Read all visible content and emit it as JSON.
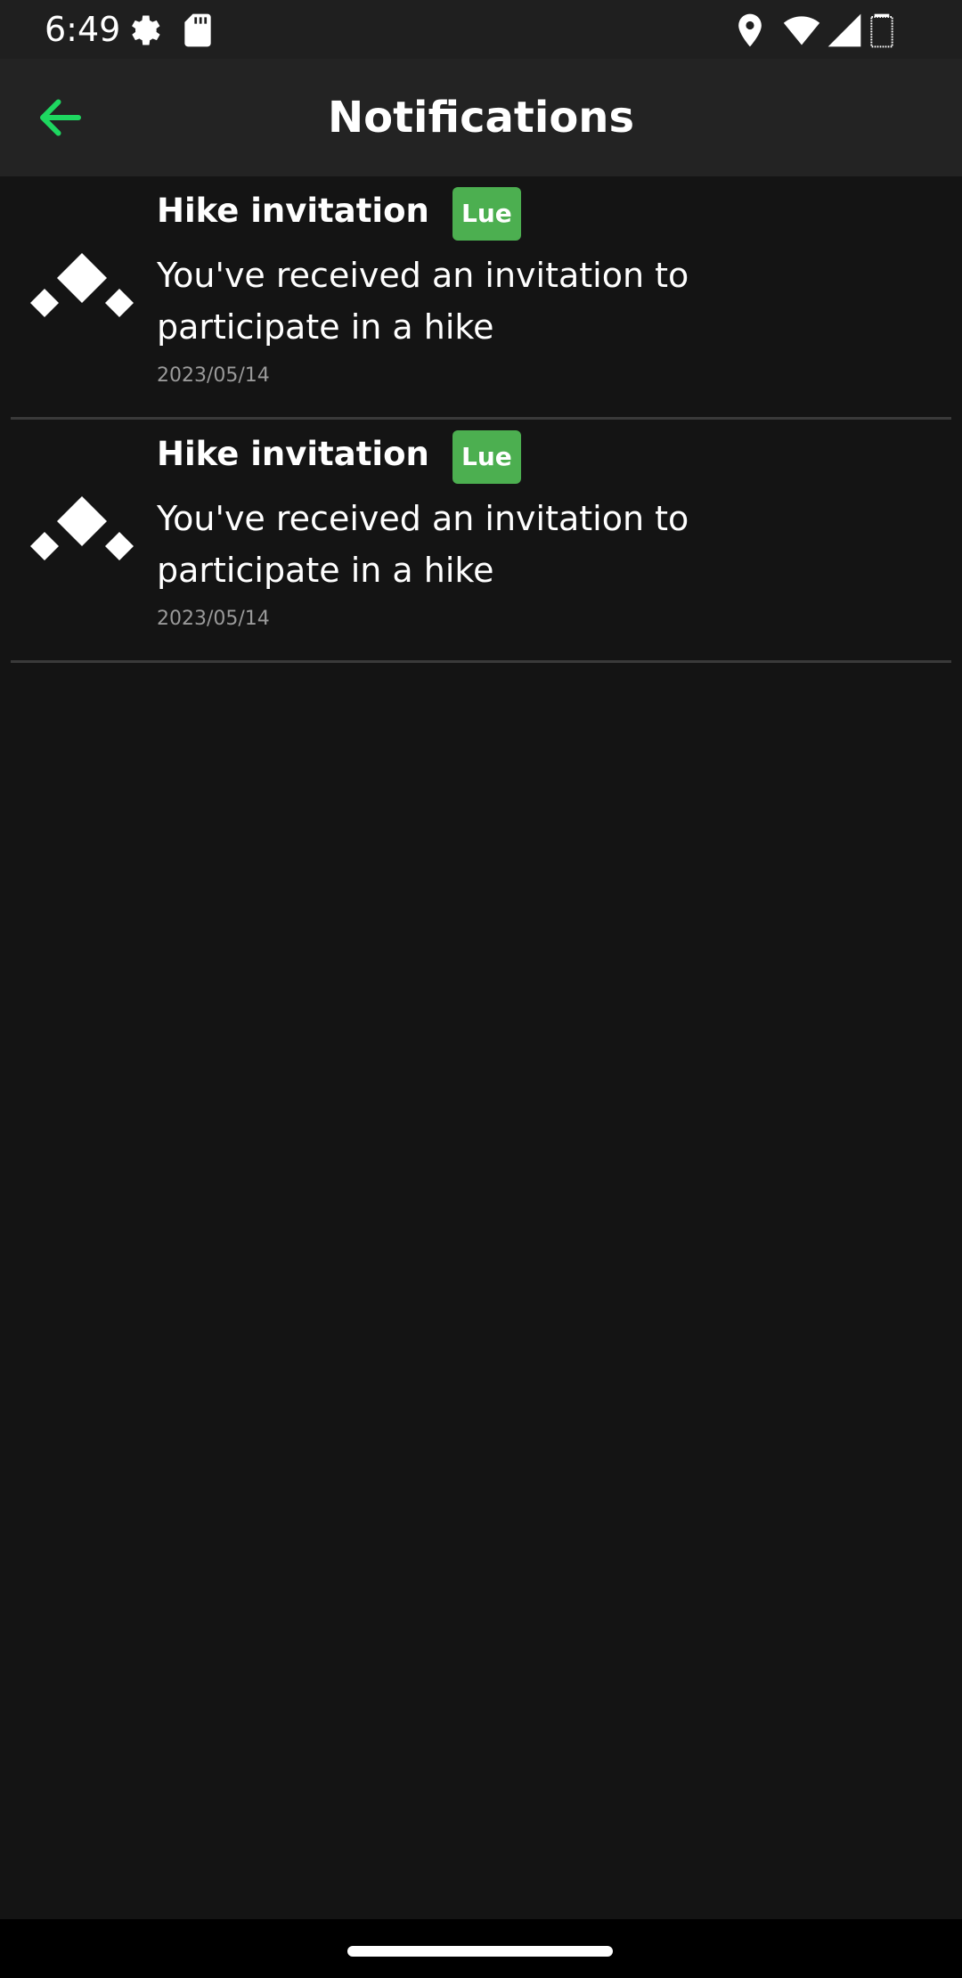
{
  "status_bar": {
    "time": "6:49",
    "icons": [
      "settings-gear-icon",
      "sd-card-icon",
      "location-icon",
      "wifi-icon",
      "signal-icon",
      "battery-icon"
    ]
  },
  "header": {
    "title": "Notifications",
    "back_icon": "arrow-left-icon",
    "accent_color": "#1ed760"
  },
  "notifications": [
    {
      "title": "Hike invitation",
      "badge": "Lue",
      "message": "You've received an invitation to participate in a hike",
      "date": "2023/05/14",
      "icon": "mountain-logo-icon"
    },
    {
      "title": "Hike invitation",
      "badge": "Lue",
      "message": "You've received an invitation to participate in a hike",
      "date": "2023/05/14",
      "icon": "mountain-logo-icon"
    }
  ],
  "colors": {
    "background": "#141414",
    "app_bar": "#232323",
    "badge": "#4caf50",
    "divider": "#3a3a3a",
    "date_text": "#9a9a9a"
  }
}
